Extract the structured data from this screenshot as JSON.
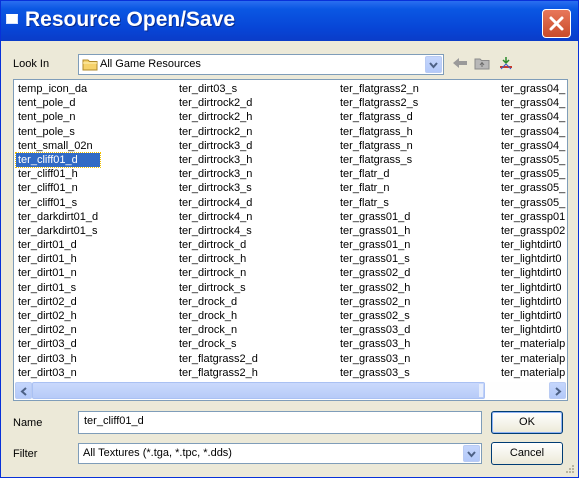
{
  "window": {
    "title": "Resource Open/Save"
  },
  "look_in": {
    "label": "Look In",
    "value": "All Game Resources"
  },
  "toolbar": {
    "icons": [
      "back-arrow-icon",
      "up-folder-icon",
      "new-folder-icon"
    ]
  },
  "files": {
    "selected": "ter_cliff01_d",
    "columns": [
      [
        "temp_icon_da",
        "tent_pole_d",
        "tent_pole_n",
        "tent_pole_s",
        "tent_small_02n",
        "ter_cliff01_d",
        "ter_cliff01_h",
        "ter_cliff01_n",
        "ter_cliff01_s",
        "ter_darkdirt01_d",
        "ter_darkdirt01_s",
        "ter_dirt01_d",
        "ter_dirt01_h",
        "ter_dirt01_n",
        "ter_dirt01_s",
        "ter_dirt02_d",
        "ter_dirt02_h",
        "ter_dirt02_n",
        "ter_dirt03_d",
        "ter_dirt03_h",
        "ter_dirt03_n"
      ],
      [
        "ter_dirt03_s",
        "ter_dirtrock2_d",
        "ter_dirtrock2_h",
        "ter_dirtrock2_n",
        "ter_dirtrock3_d",
        "ter_dirtrock3_h",
        "ter_dirtrock3_n",
        "ter_dirtrock3_s",
        "ter_dirtrock4_d",
        "ter_dirtrock4_n",
        "ter_dirtrock4_s",
        "ter_dirtrock_d",
        "ter_dirtrock_h",
        "ter_dirtrock_n",
        "ter_dirtrock_s",
        "ter_drock_d",
        "ter_drock_h",
        "ter_drock_n",
        "ter_drock_s",
        "ter_flatgrass2_d",
        "ter_flatgrass2_h"
      ],
      [
        "ter_flatgrass2_n",
        "ter_flatgrass2_s",
        "ter_flatgrass_d",
        "ter_flatgrass_h",
        "ter_flatgrass_n",
        "ter_flatgrass_s",
        "ter_flatr_d",
        "ter_flatr_n",
        "ter_flatr_s",
        "ter_grass01_d",
        "ter_grass01_h",
        "ter_grass01_n",
        "ter_grass01_s",
        "ter_grass02_d",
        "ter_grass02_h",
        "ter_grass02_n",
        "ter_grass02_s",
        "ter_grass03_d",
        "ter_grass03_h",
        "ter_grass03_n",
        "ter_grass03_s"
      ],
      [
        "ter_grass04_",
        "ter_grass04_",
        "ter_grass04_",
        "ter_grass04_",
        "ter_grass04_",
        "ter_grass05_",
        "ter_grass05_",
        "ter_grass05_",
        "ter_grass05_",
        "ter_grassp01",
        "ter_grassp02",
        "ter_lightdirt0",
        "ter_lightdirt0",
        "ter_lightdirt0",
        "ter_lightdirt0",
        "ter_lightdirt0",
        "ter_lightdirt0",
        "ter_lightdirt0",
        "ter_materialp",
        "ter_materialp",
        "ter_materialp"
      ]
    ]
  },
  "name_field": {
    "label": "Name",
    "value": "ter_cliff01_d"
  },
  "filter": {
    "label": "Filter",
    "value": "All Textures (*.tga, *.tpc, *.dds)"
  },
  "buttons": {
    "ok": "OK",
    "cancel": "Cancel"
  },
  "colors": {
    "titlebar": "#0845d6",
    "selection": "#316ac5",
    "dialog_bg": "#ece9d8"
  }
}
